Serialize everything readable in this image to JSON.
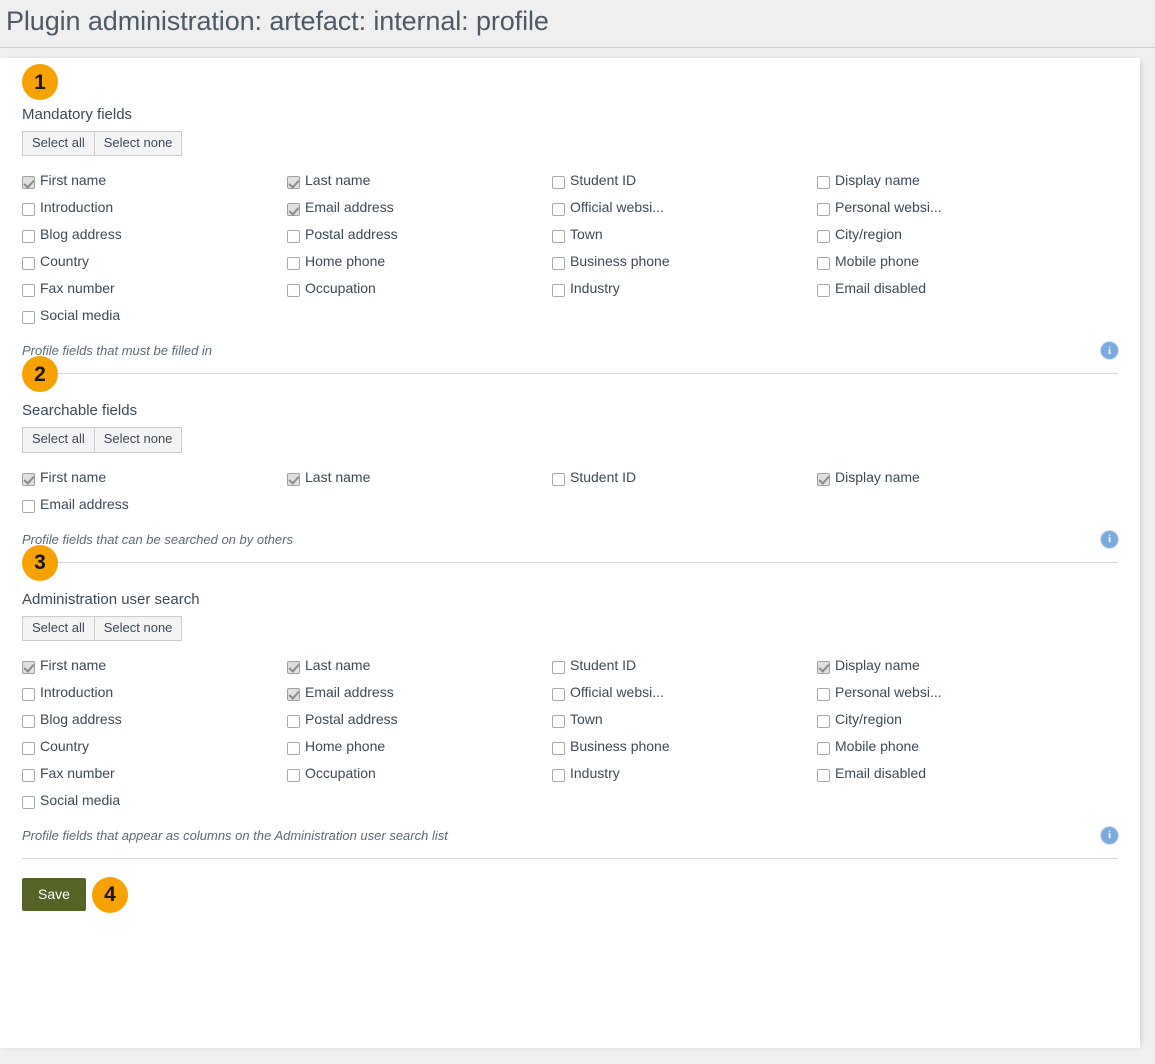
{
  "header": {
    "title": "Plugin administration: artefact: internal: profile"
  },
  "buttons": {
    "select_all": "Select all",
    "select_none": "Select none",
    "save": "Save"
  },
  "icons": {
    "info": "i",
    "info_name": "info-icon"
  },
  "sections": [
    {
      "badge": "1",
      "label": "Mandatory fields",
      "help": "Profile fields that must be filled in",
      "fields": [
        {
          "label": "First name",
          "checked": true
        },
        {
          "label": "Last name",
          "checked": true
        },
        {
          "label": "Student ID",
          "checked": false
        },
        {
          "label": "Display name",
          "checked": false
        },
        {
          "label": "Introduction",
          "checked": false
        },
        {
          "label": "Email address",
          "checked": true
        },
        {
          "label": "Official websi...",
          "checked": false
        },
        {
          "label": "Personal websi...",
          "checked": false
        },
        {
          "label": "Blog address",
          "checked": false
        },
        {
          "label": "Postal address",
          "checked": false
        },
        {
          "label": "Town",
          "checked": false
        },
        {
          "label": "City/region",
          "checked": false
        },
        {
          "label": "Country",
          "checked": false
        },
        {
          "label": "Home phone",
          "checked": false
        },
        {
          "label": "Business phone",
          "checked": false
        },
        {
          "label": "Mobile phone",
          "checked": false
        },
        {
          "label": "Fax number",
          "checked": false
        },
        {
          "label": "Occupation",
          "checked": false
        },
        {
          "label": "Industry",
          "checked": false
        },
        {
          "label": "Email disabled",
          "checked": false
        },
        {
          "label": "Social media",
          "checked": false
        }
      ]
    },
    {
      "badge": "2",
      "label": "Searchable fields",
      "help": "Profile fields that can be searched on by others",
      "fields": [
        {
          "label": "First name",
          "checked": true
        },
        {
          "label": "Last name",
          "checked": true
        },
        {
          "label": "Student ID",
          "checked": false
        },
        {
          "label": "Display name",
          "checked": true
        },
        {
          "label": "Email address",
          "checked": false
        }
      ]
    },
    {
      "badge": "3",
      "label": "Administration user search",
      "help": "Profile fields that appear as columns on the Administration user search list",
      "fields": [
        {
          "label": "First name",
          "checked": true
        },
        {
          "label": "Last name",
          "checked": true
        },
        {
          "label": "Student ID",
          "checked": false
        },
        {
          "label": "Display name",
          "checked": true
        },
        {
          "label": "Introduction",
          "checked": false
        },
        {
          "label": "Email address",
          "checked": true
        },
        {
          "label": "Official websi...",
          "checked": false
        },
        {
          "label": "Personal websi...",
          "checked": false
        },
        {
          "label": "Blog address",
          "checked": false
        },
        {
          "label": "Postal address",
          "checked": false
        },
        {
          "label": "Town",
          "checked": false
        },
        {
          "label": "City/region",
          "checked": false
        },
        {
          "label": "Country",
          "checked": false
        },
        {
          "label": "Home phone",
          "checked": false
        },
        {
          "label": "Business phone",
          "checked": false
        },
        {
          "label": "Mobile phone",
          "checked": false
        },
        {
          "label": "Fax number",
          "checked": false
        },
        {
          "label": "Occupation",
          "checked": false
        },
        {
          "label": "Industry",
          "checked": false
        },
        {
          "label": "Email disabled",
          "checked": false
        },
        {
          "label": "Social media",
          "checked": false
        }
      ]
    }
  ],
  "footer": {
    "badge": "4"
  },
  "colors": {
    "badge": "#f5a202",
    "save_button": "#566327",
    "info_icon": "#7aaade",
    "page_background": "#efefef"
  }
}
